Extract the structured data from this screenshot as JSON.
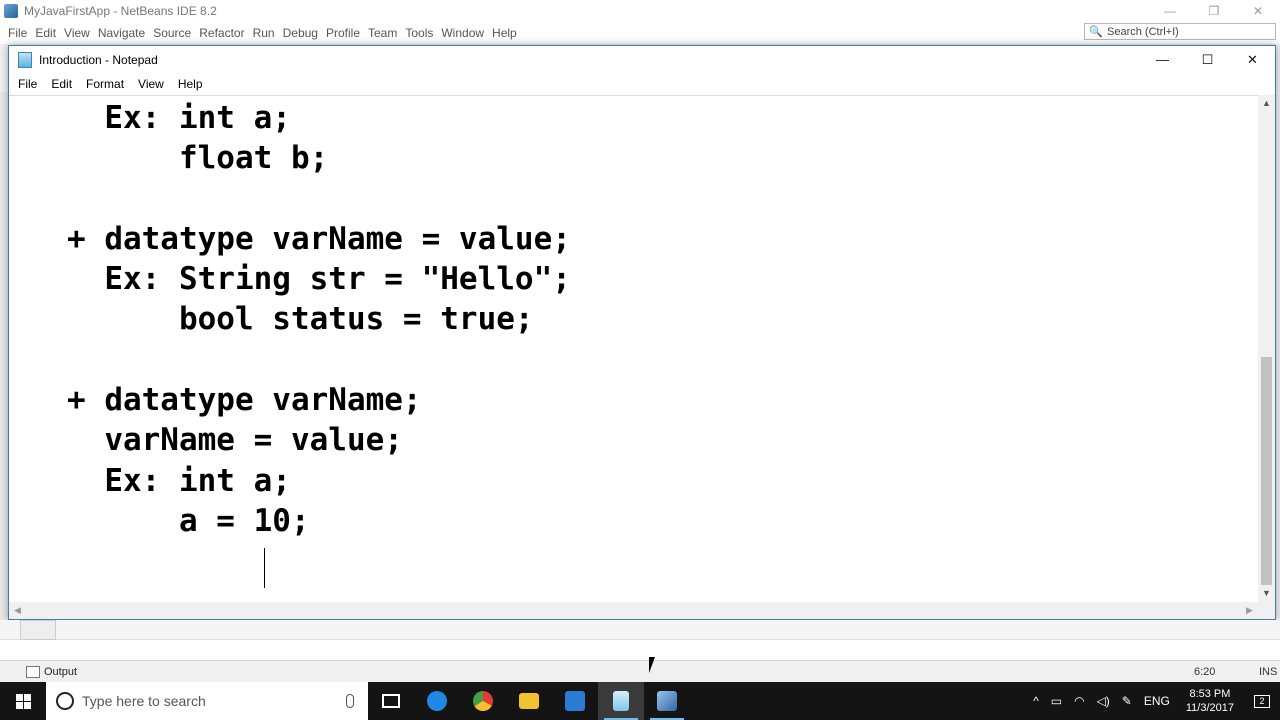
{
  "netbeans": {
    "title": "MyJavaFirstApp - NetBeans IDE 8.2",
    "menu": [
      "File",
      "Edit",
      "View",
      "Navigate",
      "Source",
      "Refactor",
      "Run",
      "Debug",
      "Profile",
      "Team",
      "Tools",
      "Window",
      "Help"
    ],
    "search_placeholder": "Search (Ctrl+I)",
    "window_controls": [
      "—",
      "❐",
      "✕"
    ],
    "status": {
      "output_label": "Output",
      "position": "6:20",
      "mode": "INS"
    }
  },
  "notepad": {
    "title": "Introduction - Notepad",
    "window_controls": [
      "—",
      "☐",
      "✕"
    ],
    "menu": [
      "File",
      "Edit",
      "Format",
      "View",
      "Help"
    ],
    "lines": [
      "     Ex: int a;",
      "         float b;",
      "",
      "   + datatype varName = value;",
      "     Ex: String str = \"Hello\";",
      "         bool status = true;",
      "",
      "   + datatype varName;",
      "     varName = value;",
      "     Ex: int a;",
      "         a = 10;"
    ]
  },
  "taskbar": {
    "search_placeholder": "Type here to search",
    "apps": [
      {
        "name": "task-view",
        "color": "#ffffff"
      },
      {
        "name": "edge",
        "color": "#1e88e5"
      },
      {
        "name": "chrome",
        "color": "#e53935"
      },
      {
        "name": "file-explorer",
        "color": "#f2c230"
      },
      {
        "name": "store",
        "color": "#2a7bd4"
      },
      {
        "name": "notepad",
        "color": "#7fc6ea"
      },
      {
        "name": "netbeans",
        "color": "#4f86c6"
      }
    ],
    "language": "ENG",
    "time": "8:53 PM",
    "date": "11/3/2017",
    "notification_count": "2"
  }
}
